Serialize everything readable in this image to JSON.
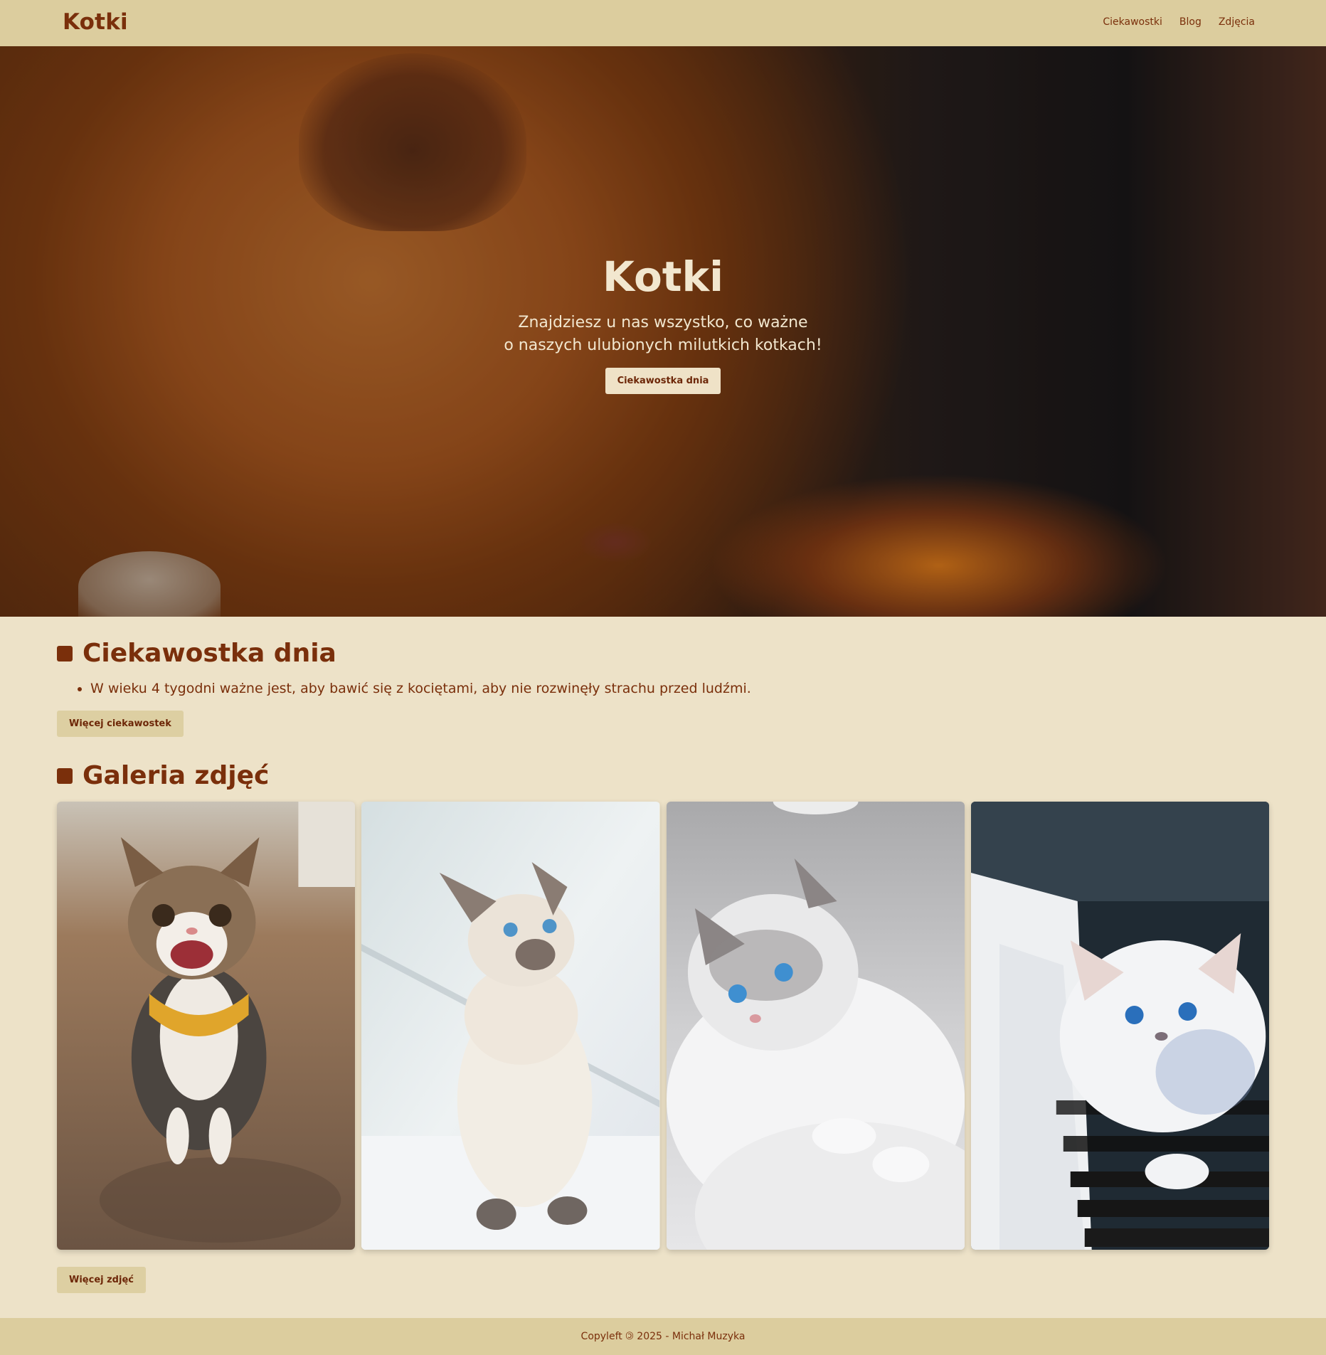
{
  "header": {
    "brand": "Kotki",
    "nav": [
      {
        "label": "Ciekawostki"
      },
      {
        "label": "Blog"
      },
      {
        "label": "Zdjęcia"
      }
    ]
  },
  "hero": {
    "title": "Kotki",
    "subtitle_line1": "Znajdziesz u nas wszystko, co ważne",
    "subtitle_line2": "o naszych ulubionych milutkich kotkach!",
    "button": "Ciekawostka dnia"
  },
  "fact_section": {
    "title": "Ciekawostka dnia",
    "facts": [
      "W wieku 4 tygodni ważne jest, aby bawić się z kociętami, aby nie rozwinęły strachu przed ludźmi."
    ],
    "button": "Więcej ciekawostek"
  },
  "gallery_section": {
    "title": "Galeria zdjęć",
    "button": "Więcej zdjęć"
  },
  "footer": {
    "text": "Copyleft 🄯 2025 - Michał Muzyka"
  },
  "colors": {
    "accent": "#7a2f0b",
    "header_bg": "#dccd9e",
    "page_bg": "#ede2c8",
    "hero_button_bg": "#efe2c7",
    "button_bg": "#ddcfa2"
  }
}
